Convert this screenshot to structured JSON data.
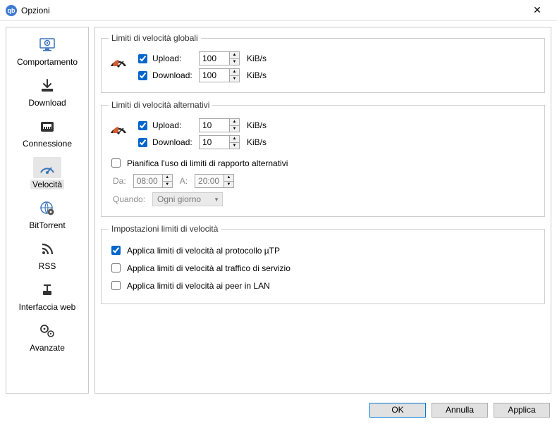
{
  "window": {
    "title": "Opzioni"
  },
  "sidebar": {
    "items": [
      {
        "label": "Comportamento"
      },
      {
        "label": "Download"
      },
      {
        "label": "Connessione"
      },
      {
        "label": "Velocità"
      },
      {
        "label": "BitTorrent"
      },
      {
        "label": "RSS"
      },
      {
        "label": "Interfaccia web"
      },
      {
        "label": "Avanzate"
      }
    ],
    "selected_index": 3
  },
  "sections": {
    "global": {
      "legend": "Limiti di velocità globali",
      "upload": {
        "label": "Upload:",
        "value": "100",
        "unit": "KiB/s",
        "checked": true
      },
      "download": {
        "label": "Download:",
        "value": "100",
        "unit": "KiB/s",
        "checked": true
      }
    },
    "alternative": {
      "legend": "Limiti di velocità alternativi",
      "upload": {
        "label": "Upload:",
        "value": "10",
        "unit": "KiB/s",
        "checked": true
      },
      "download": {
        "label": "Download:",
        "value": "10",
        "unit": "KiB/s",
        "checked": true
      },
      "schedule": {
        "label": "Pianifica l'uso di limiti di rapporto alternativi",
        "checked": false,
        "from_label": "Da:",
        "from_value": "08:00",
        "to_label": "A:",
        "to_value": "20:00",
        "when_label": "Quando:",
        "when_value": "Ogni giorno"
      }
    },
    "settings": {
      "legend": "Impostazioni limiti di velocità",
      "utp": {
        "label": "Applica limiti di velocità al protocollo µTP",
        "checked": true
      },
      "overhead": {
        "label": "Applica limiti di velocità al traffico di servizio",
        "checked": false
      },
      "lan": {
        "label": "Applica limiti di velocità ai peer in LAN",
        "checked": false
      }
    }
  },
  "buttons": {
    "ok": "OK",
    "cancel": "Annulla",
    "apply": "Applica"
  }
}
